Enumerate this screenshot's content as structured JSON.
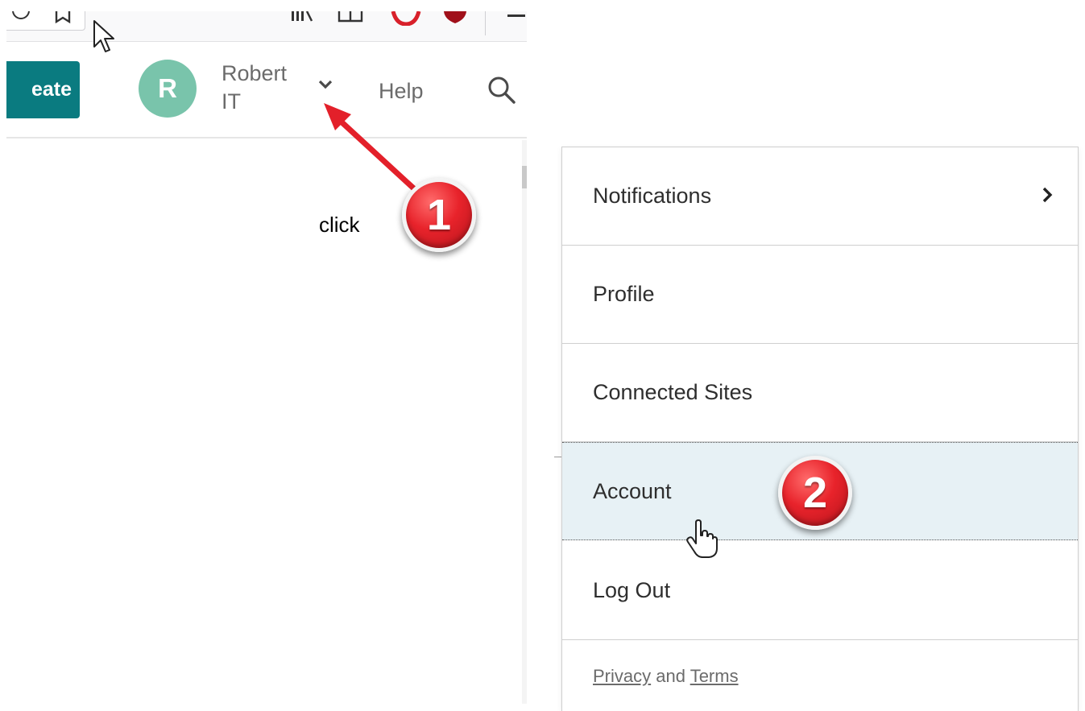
{
  "header": {
    "create_label": "eate",
    "avatar_initial": "R",
    "user_first": "Robert",
    "user_last": "IT",
    "help_label": "Help"
  },
  "annotations": {
    "click_label": "click",
    "step1": "1",
    "step2": "2"
  },
  "menu": {
    "items": [
      {
        "label": "Notifications",
        "has_submenu": true
      },
      {
        "label": "Profile"
      },
      {
        "label": "Connected Sites"
      },
      {
        "label": "Account",
        "hovered": true
      },
      {
        "label": "Log Out"
      }
    ],
    "footer": {
      "privacy": "Privacy",
      "and": "and",
      "terms": "Terms"
    }
  },
  "colors": {
    "create_button": "#0a7b80",
    "avatar": "#79c4ab",
    "hover_row": "#e7f1f5",
    "annotation_red": "#e8232b"
  },
  "icons": [
    "search-icon",
    "chevron-down-icon",
    "chevron-right-icon",
    "arrow-pointer-cursor",
    "hand-pointer-cursor"
  ]
}
